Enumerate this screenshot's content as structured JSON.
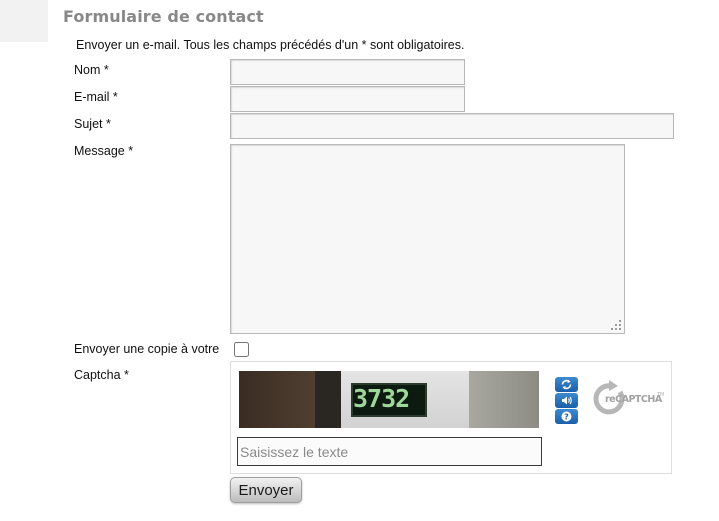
{
  "form": {
    "title": "Formulaire de contact",
    "intro": "Envoyer un e-mail. Tous les champs précédés d'un * sont obligatoires.",
    "fields": {
      "name": {
        "label": "Nom *",
        "value": ""
      },
      "email": {
        "label": "E-mail *",
        "value": ""
      },
      "subject": {
        "label": "Sujet *",
        "value": ""
      },
      "message": {
        "label": "Message *",
        "value": ""
      }
    },
    "copy": {
      "label": "Envoyer une copie à votre",
      "checked": false
    },
    "captcha": {
      "label": "Captcha *",
      "image_text": "3732",
      "input_placeholder": "Saisissez le texte",
      "input_value": "",
      "logo_text": "reCAPTCHA",
      "logo_tm": "TM",
      "buttons": [
        "reload-icon",
        "audio-icon",
        "help-icon"
      ]
    },
    "submit_label": "Envoyer"
  },
  "colors": {
    "title": "#888888",
    "field_bg": "#f7f7f7",
    "field_border": "#b8b8b8",
    "captcha_button": "#1a5fa8",
    "captcha_plate_text": "#9fd69a"
  }
}
